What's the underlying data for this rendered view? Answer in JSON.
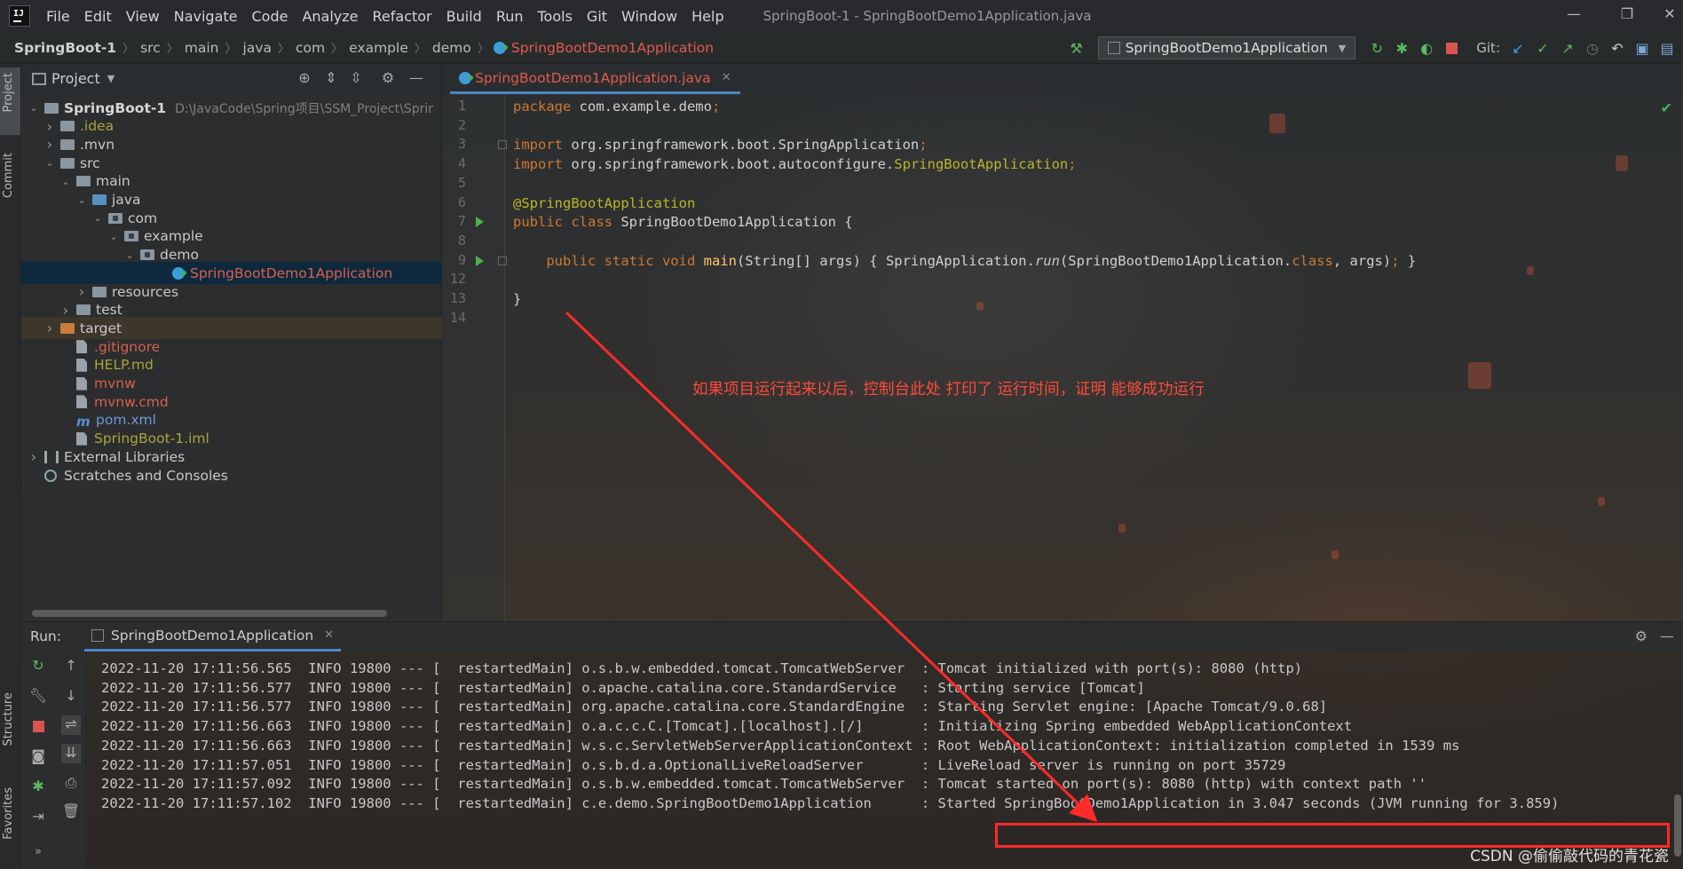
{
  "window": {
    "menu": [
      "File",
      "Edit",
      "View",
      "Navigate",
      "Code",
      "Analyze",
      "Refactor",
      "Build",
      "Run",
      "Tools",
      "Git",
      "Window",
      "Help"
    ],
    "title": "SpringBoot-1 - SpringBootDemo1Application.java",
    "controls": {
      "minimize": "—",
      "restore": "❐",
      "close": "✕"
    }
  },
  "breadcrumb": [
    "SpringBoot-1",
    "src",
    "main",
    "java",
    "com",
    "example",
    "demo",
    "SpringBootDemo1Application"
  ],
  "toolbar": {
    "run_config": "SpringBootDemo1Application",
    "git_label": "Git:",
    "icons": [
      "hammer-icon",
      "rerun-icon",
      "debug-icon",
      "coverage-icon",
      "stop-icon",
      "git-update-icon",
      "git-commit-icon",
      "git-push-icon",
      "history-icon",
      "rollback-icon",
      "project-structure-icon",
      "layout-icon"
    ]
  },
  "left_strip": {
    "project_tab": "Project",
    "commit_tab": "Commit",
    "structure_tab": "Structure",
    "favorites_tab": "Favorites"
  },
  "project": {
    "title": "Project",
    "tree": [
      {
        "label": "SpringBoot-1",
        "extra": "D:\\JavaCode\\Spring项目\\SSM_Project\\Sprir",
        "depth": 0,
        "arrow": "down",
        "icon": "folder",
        "color": "bold"
      },
      {
        "label": ".idea",
        "depth": 1,
        "arrow": "right",
        "icon": "folder",
        "color": "olive"
      },
      {
        "label": ".mvn",
        "depth": 1,
        "arrow": "right",
        "icon": "folder",
        "color": "def"
      },
      {
        "label": "src",
        "depth": 1,
        "arrow": "down",
        "icon": "folder",
        "color": "def"
      },
      {
        "label": "main",
        "depth": 2,
        "arrow": "down",
        "icon": "folder",
        "color": "def"
      },
      {
        "label": "java",
        "depth": 3,
        "arrow": "down",
        "icon": "folder-blue",
        "color": "def"
      },
      {
        "label": "com",
        "depth": 4,
        "arrow": "down",
        "icon": "package",
        "color": "def"
      },
      {
        "label": "example",
        "depth": 5,
        "arrow": "down",
        "icon": "package",
        "color": "def"
      },
      {
        "label": "demo",
        "depth": 6,
        "arrow": "down",
        "icon": "package",
        "color": "def"
      },
      {
        "label": "SpringBootDemo1Application",
        "depth": 8,
        "arrow": "",
        "icon": "class",
        "color": "red",
        "selected": true
      },
      {
        "label": "resources",
        "depth": 3,
        "arrow": "right",
        "icon": "folder",
        "color": "def"
      },
      {
        "label": "test",
        "depth": 2,
        "arrow": "right",
        "icon": "folder",
        "color": "def"
      },
      {
        "label": "target",
        "depth": 1,
        "arrow": "right",
        "icon": "folder-orange",
        "color": "def",
        "highlight": true
      },
      {
        "label": ".gitignore",
        "depth": 2,
        "arrow": "",
        "icon": "file",
        "color": "red"
      },
      {
        "label": "HELP.md",
        "depth": 2,
        "arrow": "",
        "icon": "file",
        "color": "olive"
      },
      {
        "label": "mvnw",
        "depth": 2,
        "arrow": "",
        "icon": "file",
        "color": "red"
      },
      {
        "label": "mvnw.cmd",
        "depth": 2,
        "arrow": "",
        "icon": "file",
        "color": "red"
      },
      {
        "label": "pom.xml",
        "depth": 2,
        "arrow": "",
        "icon": "maven",
        "color": "blue"
      },
      {
        "label": "SpringBoot-1.iml",
        "depth": 2,
        "arrow": "",
        "icon": "file",
        "color": "olive"
      },
      {
        "label": "External Libraries",
        "depth": 0,
        "arrow": "right",
        "icon": "library",
        "color": "def"
      },
      {
        "label": "Scratches and Consoles",
        "depth": 0,
        "arrow": "",
        "icon": "scratch",
        "color": "def"
      }
    ]
  },
  "editor": {
    "tab": "SpringBootDemo1Application.java",
    "lines": [
      {
        "n": "1",
        "tokens": [
          [
            "kw",
            "package "
          ],
          [
            "cn",
            "com.example.demo"
          ],
          [
            "kw",
            ";"
          ]
        ]
      },
      {
        "n": "2",
        "tokens": []
      },
      {
        "n": "3",
        "tokens": [
          [
            "kw",
            "import "
          ],
          [
            "cn",
            "org.springframework.boot.SpringApplication"
          ],
          [
            "kw",
            ";"
          ]
        ]
      },
      {
        "n": "4",
        "tokens": [
          [
            "kw",
            "import "
          ],
          [
            "cn",
            "org.springframework.boot.autoconfigure."
          ],
          [
            "an",
            "SpringBootApplication"
          ],
          [
            "kw",
            ";"
          ]
        ]
      },
      {
        "n": "5",
        "tokens": []
      },
      {
        "n": "6",
        "tokens": [
          [
            "an",
            "@SpringBootApplication"
          ]
        ]
      },
      {
        "n": "7",
        "tokens": [
          [
            "kw",
            "public class "
          ],
          [
            "cn",
            "SpringBootDemo1Application {"
          ]
        ]
      },
      {
        "n": "8",
        "tokens": []
      },
      {
        "n": "9",
        "tokens": [
          [
            "cn",
            "    "
          ],
          [
            "kw",
            "public static void "
          ],
          [
            "fn",
            "main"
          ],
          [
            "cn",
            "(String[] args) { SpringApplication."
          ],
          [
            "it",
            "run"
          ],
          [
            "cn",
            "(SpringBootDemo1Application."
          ],
          [
            "kw",
            "class"
          ],
          [
            "cn",
            ", args)"
          ],
          [
            "kw",
            ";"
          ],
          [
            "cn",
            " }"
          ]
        ]
      },
      {
        "n": "12",
        "tokens": []
      },
      {
        "n": "13",
        "tokens": [
          [
            "cn",
            "}"
          ]
        ]
      },
      {
        "n": "14",
        "tokens": []
      }
    ],
    "annotation": "如果项目运行起来以后，控制台此处 打印了 运行时间，证明 能够成功运行"
  },
  "run": {
    "label": "Run:",
    "tab": "SpringBootDemo1Application",
    "logs": [
      "2022-11-20 17:11:56.565  INFO 19800 --- [  restartedMain] o.s.b.w.embedded.tomcat.TomcatWebServer  : Tomcat initialized with port(s): 8080 (http)",
      "2022-11-20 17:11:56.577  INFO 19800 --- [  restartedMain] o.apache.catalina.core.StandardService   : Starting service [Tomcat]",
      "2022-11-20 17:11:56.577  INFO 19800 --- [  restartedMain] org.apache.catalina.core.StandardEngine  : Starting Servlet engine: [Apache Tomcat/9.0.68]",
      "2022-11-20 17:11:56.663  INFO 19800 --- [  restartedMain] o.a.c.c.C.[Tomcat].[localhost].[/]       : Initializing Spring embedded WebApplicationContext",
      "2022-11-20 17:11:56.663  INFO 19800 --- [  restartedMain] w.s.c.ServletWebServerApplicationContext : Root WebApplicationContext: initialization completed in 1539 ms",
      "2022-11-20 17:11:57.051  INFO 19800 --- [  restartedMain] o.s.b.d.a.OptionalLiveReloadServer       : LiveReload server is running on port 35729",
      "2022-11-20 17:11:57.092  INFO 19800 --- [  restartedMain] o.s.b.w.embedded.tomcat.TomcatWebServer  : Tomcat started on port(s): 8080 (http) with context path ''",
      "2022-11-20 17:11:57.102  INFO 19800 --- [  restartedMain] c.e.demo.SpringBootDemo1Application      : Started SpringBootDemo1Application in 3.047 seconds (JVM running for 3.859)"
    ]
  },
  "watermark": "CSDN @偷偷敲代码的青花瓷",
  "colors": {
    "accent": "#4a88c7",
    "annotation_red": "#ff2a2a",
    "keyword": "#cc7832",
    "annotation": "#bbb529"
  }
}
